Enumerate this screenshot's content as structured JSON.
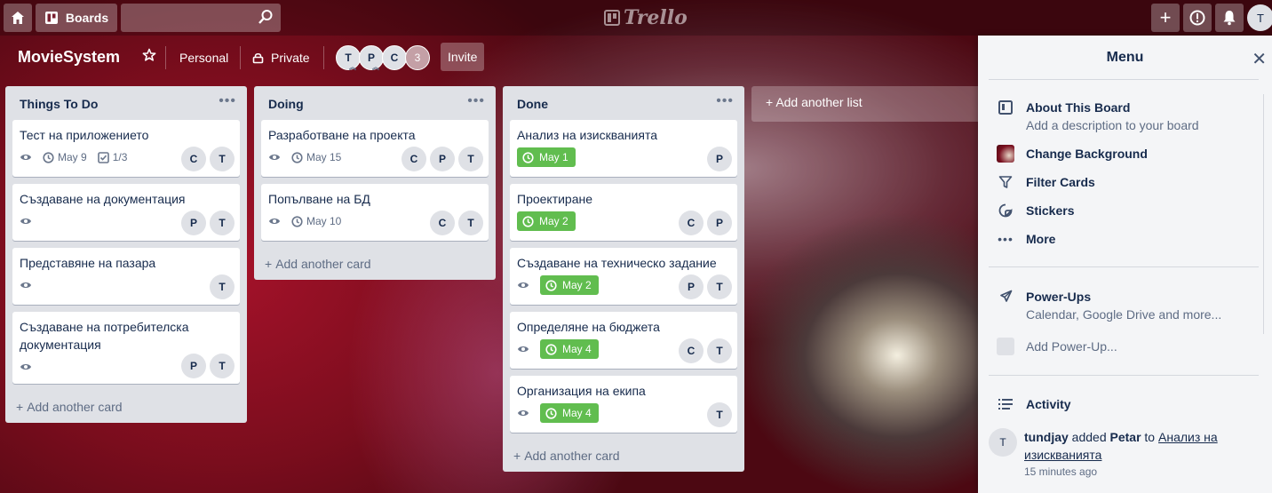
{
  "topbar": {
    "boards_label": "Boards",
    "search_placeholder": "",
    "logo_text": "Trello",
    "user_initial": "T"
  },
  "board": {
    "title": "MovieSystem",
    "team": "Personal",
    "visibility": "Private",
    "members": [
      "T",
      "P",
      "C"
    ],
    "member_count": "3",
    "invite_label": "Invite"
  },
  "lists": [
    {
      "title": "Things To Do",
      "add_card": "Add another card",
      "cards": [
        {
          "title": "Тест на приложението",
          "due": "May 9",
          "checklist": "1/3",
          "members": [
            "C",
            "T"
          ]
        },
        {
          "title": "Създаване на документация",
          "members": [
            "P",
            "T"
          ]
        },
        {
          "title": "Представяне на пазара",
          "members": [
            "T"
          ]
        },
        {
          "title": "Създаване на потребителска документация",
          "members": [
            "P",
            "T"
          ]
        }
      ]
    },
    {
      "title": "Doing",
      "add_card": "Add another card",
      "cards": [
        {
          "title": "Разработване на проекта",
          "due": "May 15",
          "members": [
            "C",
            "P",
            "T"
          ]
        },
        {
          "title": "Попълване на БД",
          "due": "May 10",
          "members": [
            "C",
            "T"
          ]
        }
      ]
    },
    {
      "title": "Done",
      "add_card": "Add another card",
      "cards": [
        {
          "title": "Анализ на изискванията",
          "due": "May 1",
          "members": [
            "P"
          ]
        },
        {
          "title": "Проектиране",
          "due": "May 2",
          "members": [
            "C",
            "P"
          ]
        },
        {
          "title": "Създаване на техническо задание",
          "due": "May 2",
          "members": [
            "P",
            "T"
          ]
        },
        {
          "title": "Определяне на бюджета",
          "due": "May 4",
          "members": [
            "C",
            "T"
          ]
        },
        {
          "title": "Организация на екипа",
          "due": "May 4",
          "members": [
            "T"
          ]
        }
      ]
    }
  ],
  "add_list_label": "Add another list",
  "menu": {
    "title": "Menu",
    "about_label": "About This Board",
    "about_sub": "Add a description to your board",
    "change_bg": "Change Background",
    "filter_cards": "Filter Cards",
    "stickers": "Stickers",
    "more": "More",
    "powerups_label": "Power-Ups",
    "powerups_sub": "Calendar, Google Drive and more...",
    "add_powerup": "Add Power-Up...",
    "activity_label": "Activity",
    "activity": {
      "avatar": "T",
      "user": "tundjay",
      "verb": "added",
      "target_user": "Petar",
      "to": "to",
      "card": "Анализ на изискванията",
      "time": "15 minutes ago"
    }
  },
  "colors": {
    "due_complete": "#61bd4f",
    "list_bg": "#dfe1e6",
    "menu_bg": "#f4f5f7"
  }
}
